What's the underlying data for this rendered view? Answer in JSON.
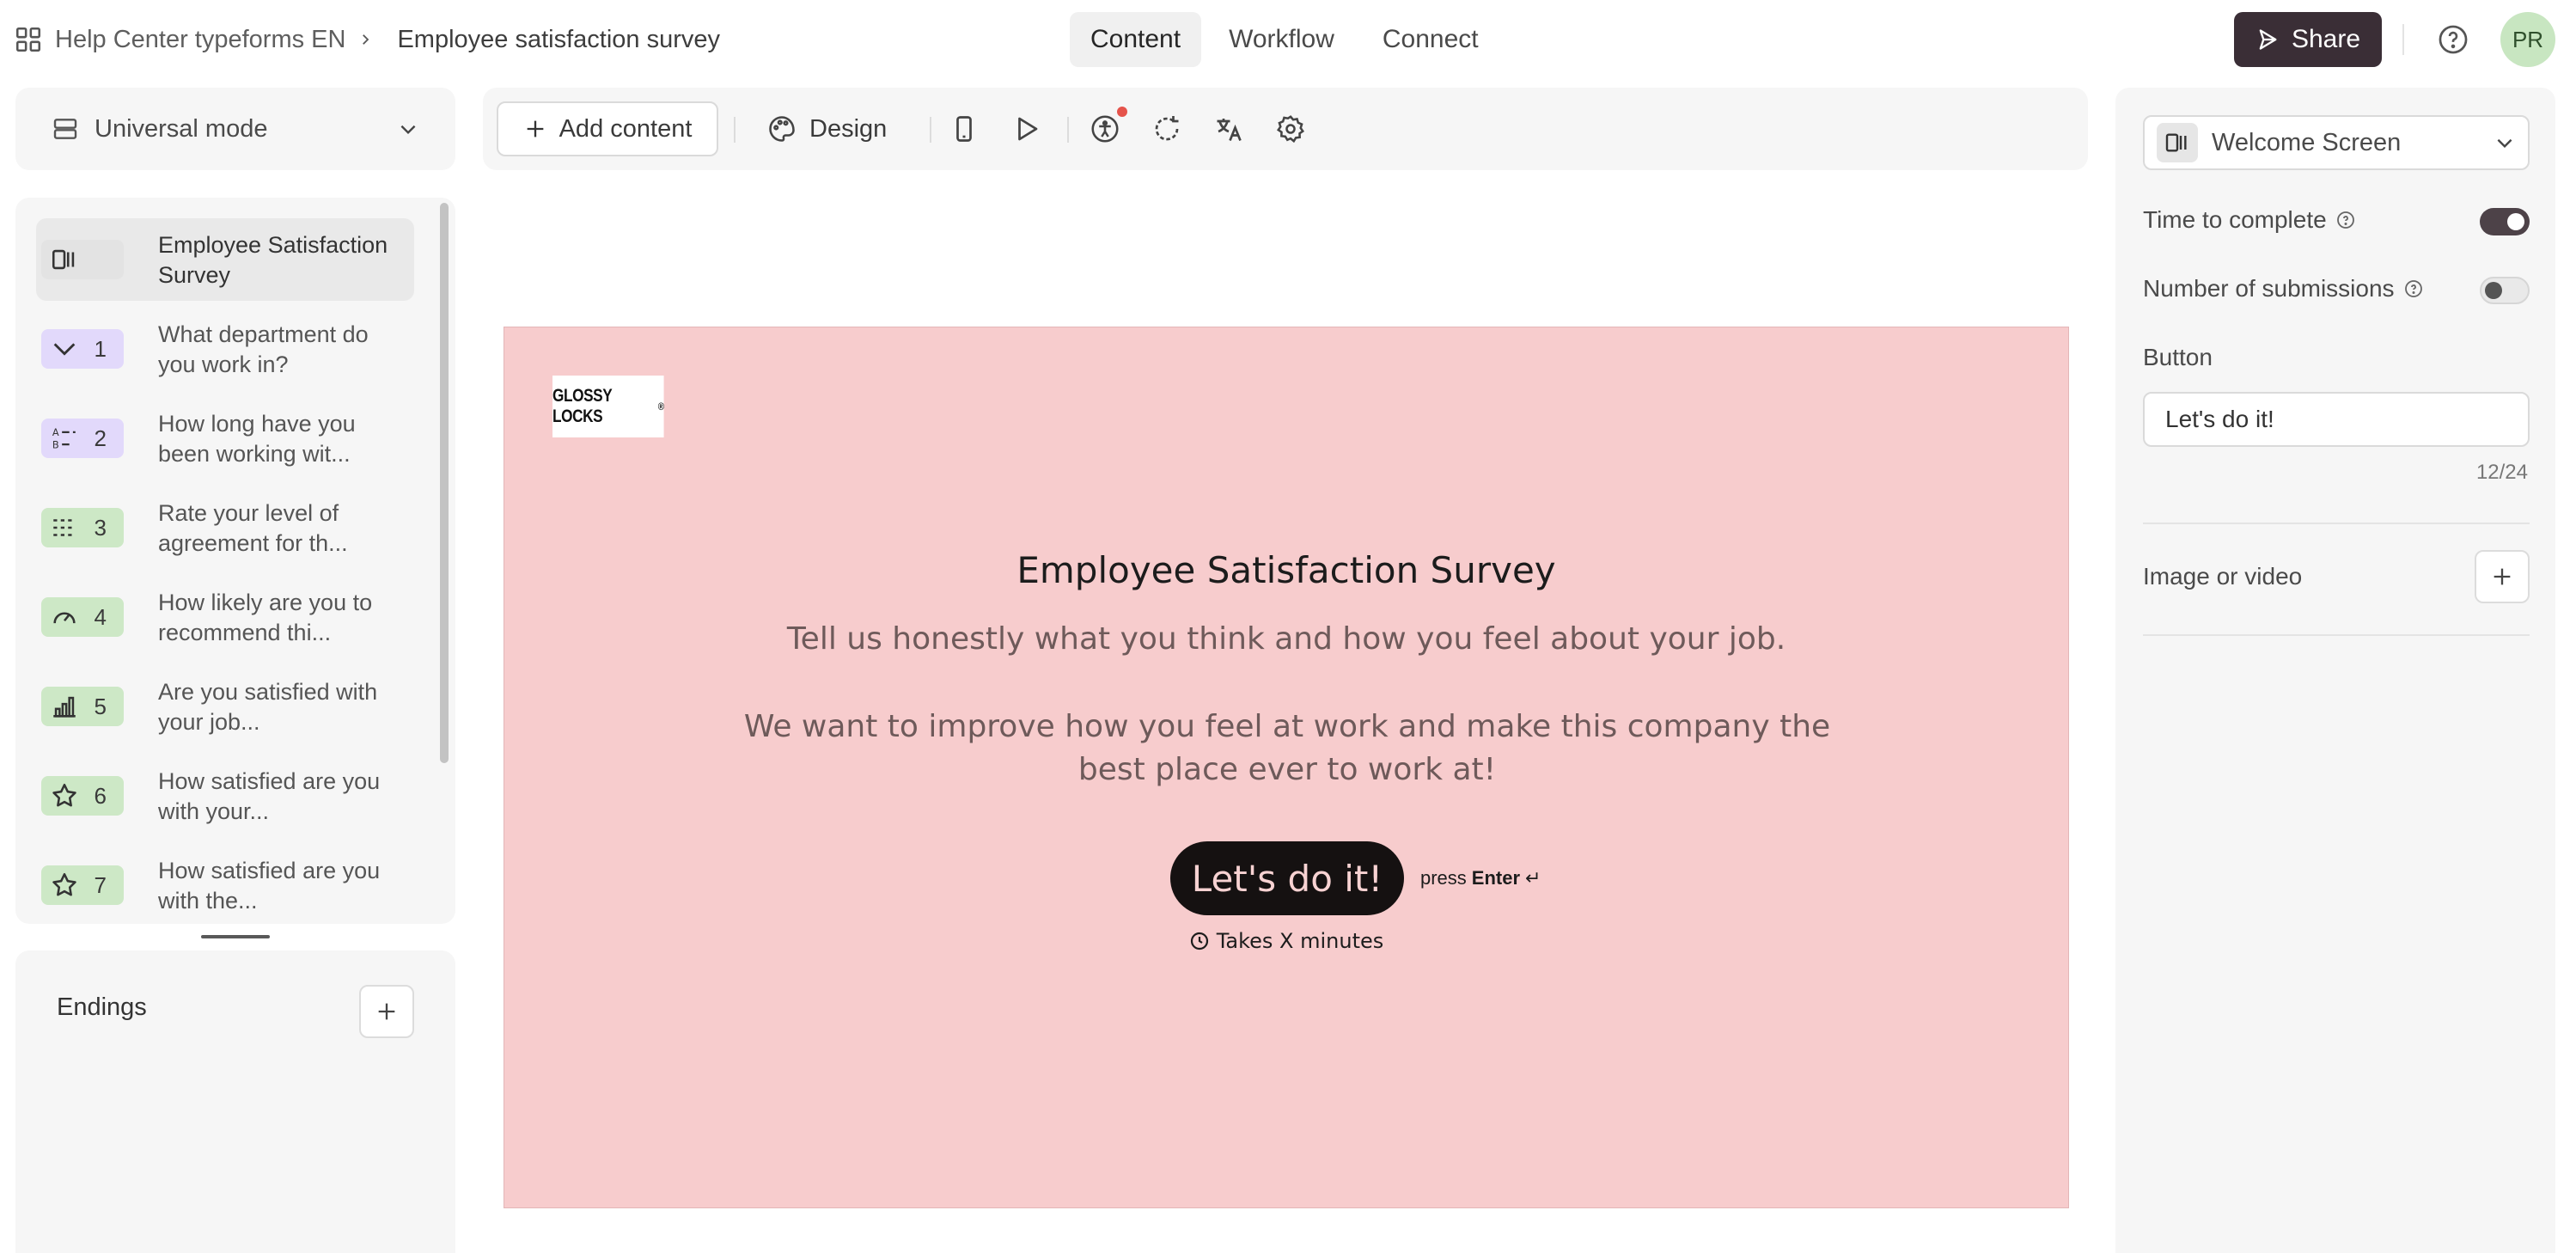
{
  "header": {
    "workspace": "Help Center typeforms EN",
    "form_title": "Employee satisfaction survey",
    "tabs": [
      {
        "label": "Content",
        "active": true
      },
      {
        "label": "Workflow",
        "active": false
      },
      {
        "label": "Connect",
        "active": false
      }
    ],
    "share_label": "Share",
    "avatar_initials": "PR"
  },
  "left_panel": {
    "mode_label": "Universal mode",
    "items": [
      {
        "num": "",
        "icon": "welcome-screen-icon",
        "label": "Employee Satisfaction Survey",
        "color": "#e3e3e3",
        "active": true
      },
      {
        "num": "1",
        "icon": "dropdown-chevron-icon",
        "label": "What department do you work in?",
        "color": "#e2d9fb"
      },
      {
        "num": "2",
        "icon": "multiple-choice-icon",
        "label": "How long have you been working wit...",
        "color": "#e2d9fb"
      },
      {
        "num": "3",
        "icon": "matrix-icon",
        "label": "Rate your level of agreement for th...",
        "color": "#cde8c6"
      },
      {
        "num": "4",
        "icon": "gauge-icon",
        "label": "How likely are you to recommend thi...",
        "color": "#cde8c6"
      },
      {
        "num": "5",
        "icon": "bar-chart-icon",
        "label": "Are you satisfied with your job...",
        "color": "#cde8c6"
      },
      {
        "num": "6",
        "icon": "star-icon",
        "label": "How satisfied are you with your...",
        "color": "#cde8c6"
      },
      {
        "num": "7",
        "icon": "star-icon",
        "label": "How satisfied are you with the...",
        "color": "#cde8c6"
      }
    ],
    "endings_label": "Endings"
  },
  "toolbar": {
    "add_content_label": "Add content",
    "design_label": "Design"
  },
  "canvas": {
    "background": "#f7cccd",
    "logo_text": "GLOSSY LOCKS",
    "logo_mark": "®",
    "title": "Employee Satisfaction Survey",
    "subtitle": "Tell us honestly what you think and how you feel about your job.",
    "description": "We want to improve how you feel at work and make this company the best place ever to work at!",
    "button_label": "Let's do it!",
    "press_text": "press",
    "enter_text": "Enter",
    "enter_symbol": "↵",
    "time_text": "Takes X minutes"
  },
  "right_panel": {
    "screen_select": "Welcome Screen",
    "time_to_complete_label": "Time to complete",
    "time_to_complete_on": true,
    "submissions_label": "Number of submissions",
    "submissions_on": false,
    "button_section_label": "Button",
    "button_value": "Let's do it!",
    "button_counter": "12/24",
    "image_label": "Image or video"
  }
}
